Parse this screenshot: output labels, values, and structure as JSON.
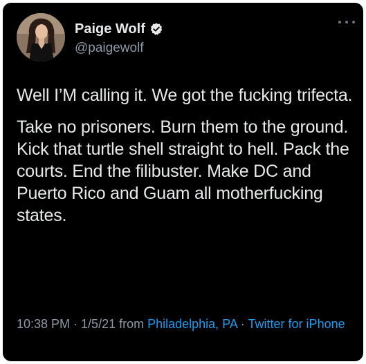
{
  "user": {
    "display_name": "Paige Wolf",
    "handle": "@paigewolf",
    "verified": true
  },
  "icons": {
    "verified": "verified-badge-icon",
    "more": "more-options-icon",
    "avatar": "profile-photo"
  },
  "tweet": {
    "paragraphs": [
      "Well I’M calling it. We got the fucking trifecta.",
      "Take no prisoners. Burn them to the ground. Kick that turtle shell straight to hell. Pack the courts. End the filibuster. Make DC and Puerto Rico and Guam all motherfucking states."
    ]
  },
  "meta": {
    "time": "10:38 PM",
    "separator": " · ",
    "date": "1/5/21",
    "from_label": " from ",
    "location": "Philadelphia, PA",
    "separator2": " · ",
    "source": "Twitter for iPhone"
  },
  "colors": {
    "background": "#000000",
    "text": "#e7e9ea",
    "secondary": "#8b98a5",
    "link": "#1d9bf0"
  }
}
